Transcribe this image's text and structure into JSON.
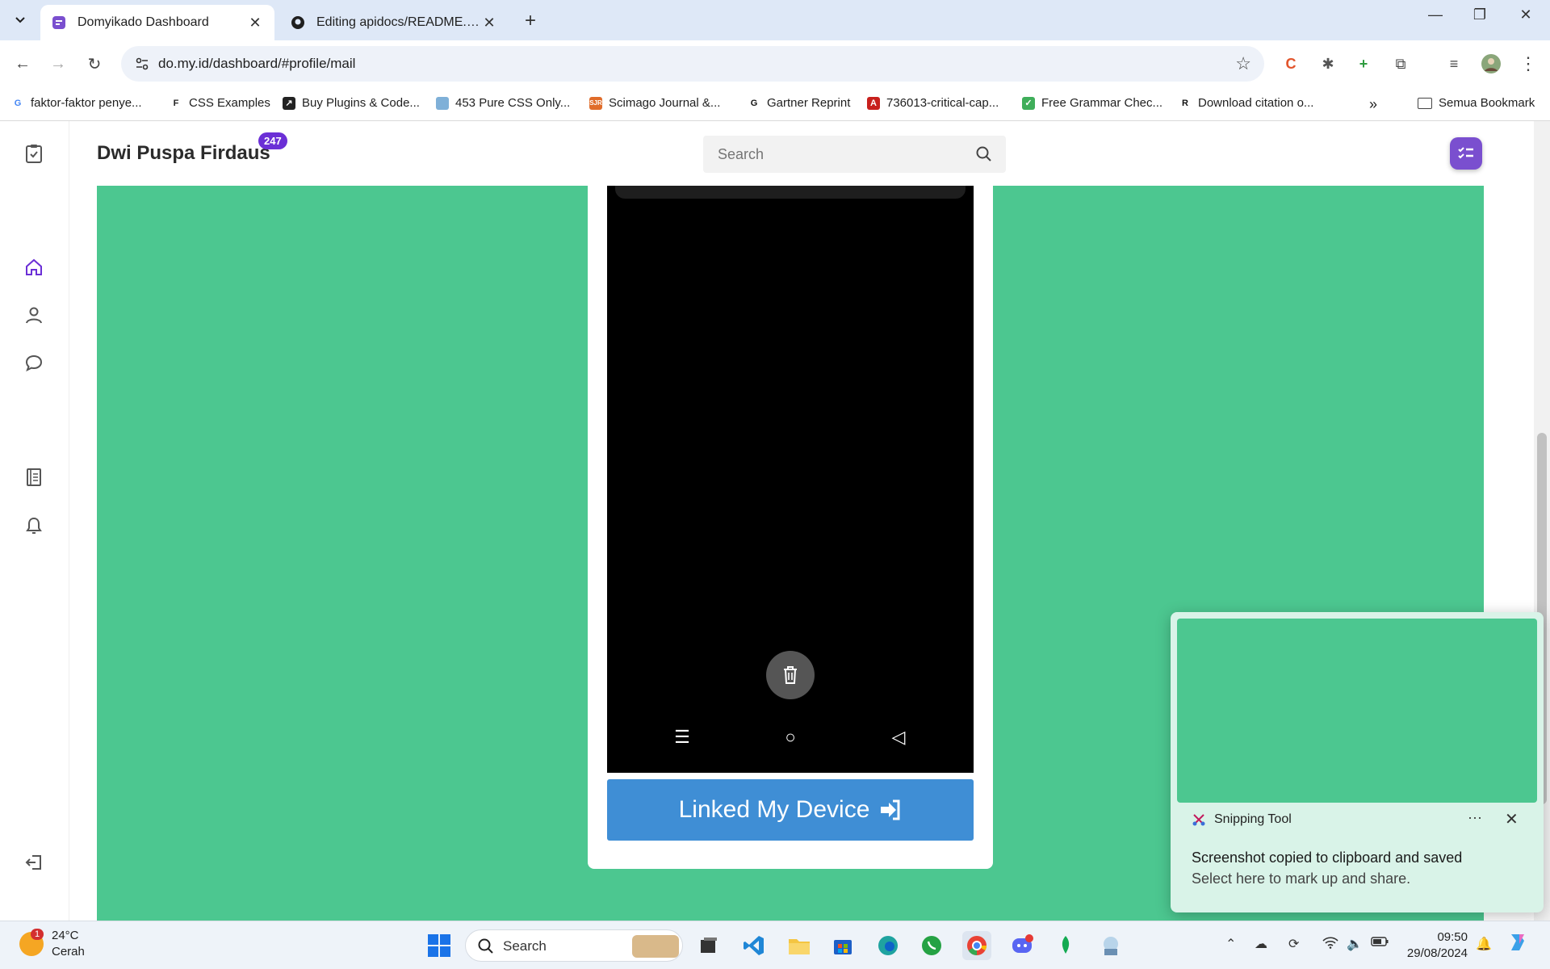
{
  "browser": {
    "tabs": [
      {
        "title": "Domyikado Dashboard",
        "active": true
      },
      {
        "title": "Editing apidocs/README.md at",
        "active": false
      }
    ],
    "url": "do.my.id/dashboard/#profile/mail",
    "bookmarks": [
      "faktor-faktor penye...",
      "CSS Examples",
      "Buy Plugins & Code...",
      "453 Pure CSS Only...",
      "Scimago Journal &...",
      "Gartner Reprint",
      "736013-critical-cap...",
      "Free Grammar Chec...",
      "Download citation o..."
    ],
    "all_bookmarks": "Semua Bookmark"
  },
  "header": {
    "user_name": "Dwi Puspa Firdaus",
    "badge_count": "247",
    "search_placeholder": "Search"
  },
  "device": {
    "link_button_label": "Linked My Device"
  },
  "toast": {
    "app_name": "Snipping Tool",
    "message": "Screenshot copied to clipboard and saved",
    "sub": "Select here to mark up and share.",
    "more": "···"
  },
  "taskbar": {
    "temp": "24°C",
    "weather": "Cerah",
    "weather_badge": "1",
    "search_label": "Search",
    "time": "09:50",
    "date": "29/08/2024"
  },
  "colors": {
    "accent_green": "#4cc790",
    "button_blue": "#3f8ed5",
    "badge_purple": "#6b2fd6"
  }
}
